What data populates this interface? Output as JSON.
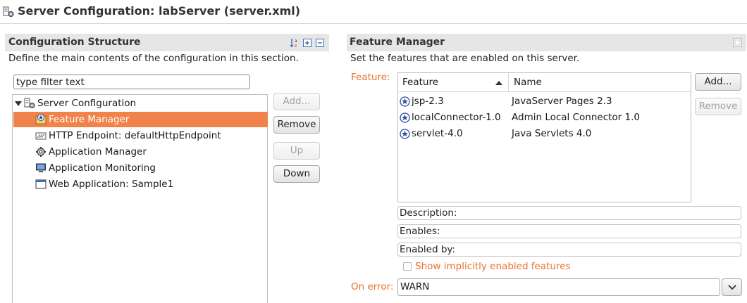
{
  "header": {
    "title": "Server Configuration: labServer (server.xml)",
    "icon": "server-config-icon"
  },
  "left_section": {
    "title": "Configuration Structure",
    "description": "Define the main contents of the configuration in this section.",
    "toolbar_icons": [
      "sort-alpha-icon",
      "expand-all-icon",
      "collapse-all-icon"
    ],
    "filter_placeholder": "type filter text",
    "tree": {
      "root": {
        "label": "Server Configuration",
        "icon": "server-config-icon",
        "expanded": true
      },
      "children": [
        {
          "label": "Feature Manager",
          "icon": "feature-manager-icon",
          "selected": true
        },
        {
          "label": "HTTP Endpoint: defaultHttpEndpoint",
          "icon": "http-endpoint-icon",
          "selected": false
        },
        {
          "label": "Application Manager",
          "icon": "gear-icon",
          "selected": false
        },
        {
          "label": "Application Monitoring",
          "icon": "monitor-icon",
          "selected": false
        },
        {
          "label": "Web Application: Sample1",
          "icon": "web-app-icon",
          "selected": false
        }
      ]
    },
    "buttons": {
      "add": "Add...",
      "remove": "Remove",
      "up": "Up",
      "down": "Down"
    }
  },
  "right_section": {
    "title": "Feature Manager",
    "description": "Set the features that are enabled on this server.",
    "feature_label": "Feature:",
    "table": {
      "columns": [
        "Feature",
        "Name"
      ],
      "sort_column": "Feature",
      "sort_direction": "ascending",
      "rows": [
        {
          "feature": "jsp-2.3",
          "name": "JavaServer Pages 2.3",
          "icon": "feature-star-icon"
        },
        {
          "feature": "localConnector-1.0",
          "name": "Admin Local Connector 1.0",
          "icon": "feature-star-icon"
        },
        {
          "feature": "servlet-4.0",
          "name": "Java Servlets 4.0",
          "icon": "feature-star-icon"
        }
      ]
    },
    "buttons": {
      "add": "Add...",
      "remove": "Remove"
    },
    "description_label": "Description:",
    "enables_label": "Enables:",
    "enabled_by_label": "Enabled by:",
    "show_implicit_label": "Show implicitly enabled features",
    "show_implicit_checked": false,
    "on_error_label": "On error:",
    "on_error_value": "WARN"
  },
  "colors": {
    "accent": "#f0824a",
    "label_orange": "#e8722c",
    "section_header_bg": "#e6e6e6"
  }
}
